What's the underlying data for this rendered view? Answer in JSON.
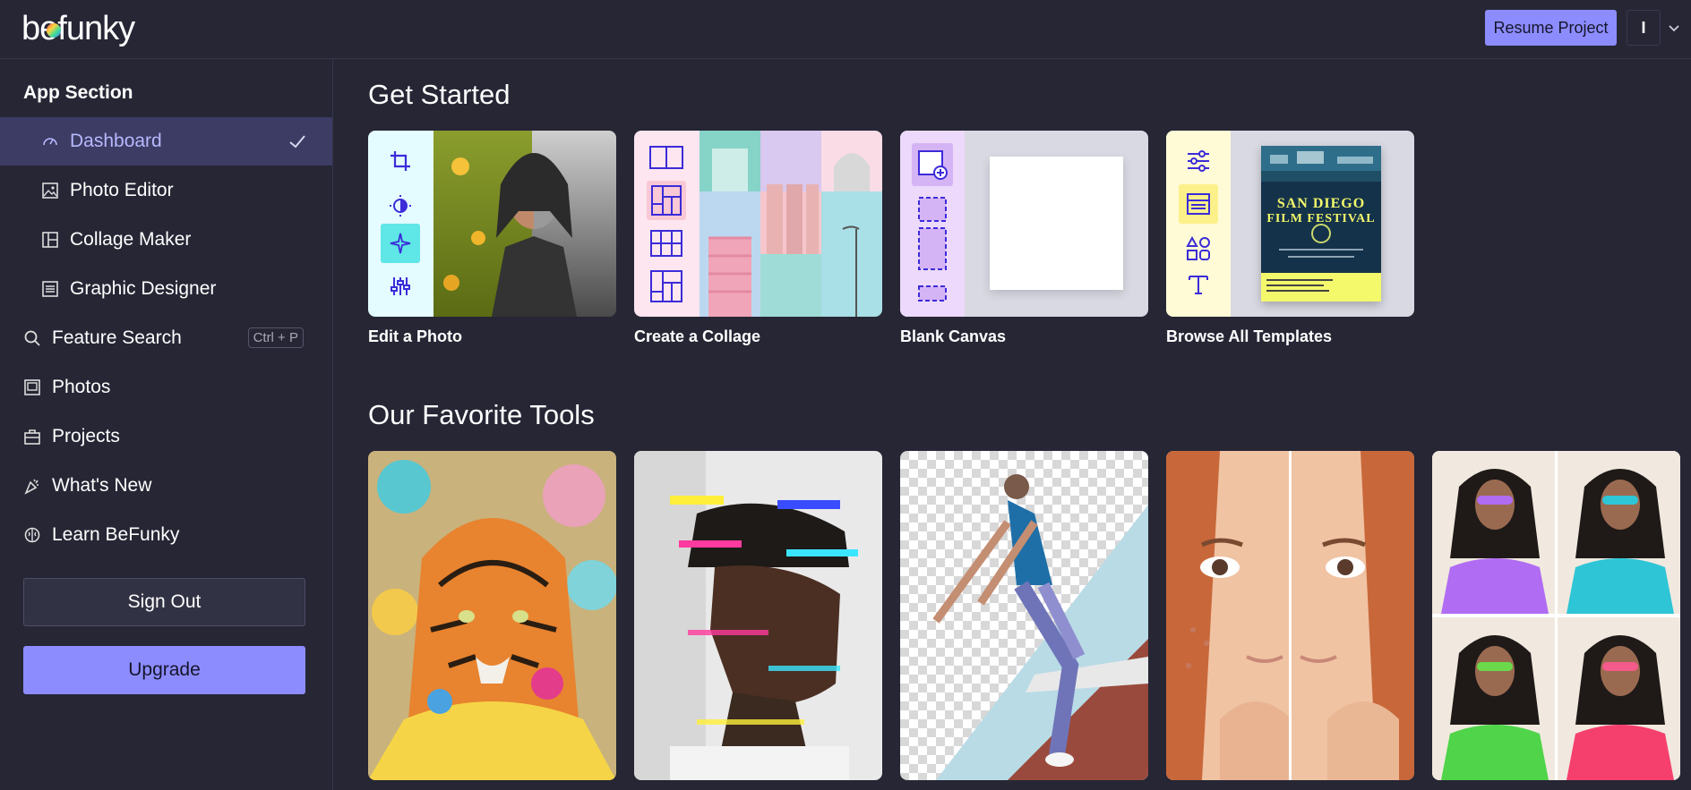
{
  "app": {
    "logo_text": "befunky"
  },
  "topbar": {
    "resume_label": "Resume Project",
    "user_initial": "I"
  },
  "sidebar": {
    "section_title": "App Section",
    "items": [
      {
        "label": "Dashboard",
        "icon": "gauge-icon",
        "active": true
      },
      {
        "label": "Photo Editor",
        "icon": "image-icon"
      },
      {
        "label": "Collage Maker",
        "icon": "collage-icon"
      },
      {
        "label": "Graphic Designer",
        "icon": "layout-icon"
      },
      {
        "label": "Feature Search",
        "icon": "search-icon",
        "shortcut": "Ctrl + P"
      },
      {
        "label": "Photos",
        "icon": "photos-icon"
      },
      {
        "label": "Projects",
        "icon": "briefcase-icon"
      },
      {
        "label": "What's New",
        "icon": "party-icon"
      },
      {
        "label": "Learn BeFunky",
        "icon": "brain-icon"
      }
    ],
    "sign_out_label": "Sign Out",
    "upgrade_label": "Upgrade"
  },
  "main": {
    "get_started_heading": "Get Started",
    "get_started_cards": [
      {
        "label": "Edit a Photo"
      },
      {
        "label": "Create a Collage"
      },
      {
        "label": "Blank Canvas"
      },
      {
        "label": "Browse All Templates"
      }
    ],
    "template_preview": {
      "line1": "SAN DIEGO",
      "line2": "FILM FESTIVAL"
    },
    "favorite_tools_heading": "Our Favorite Tools"
  },
  "colors": {
    "background": "#262635",
    "accent": "#8c8cff",
    "active_item_bg": "#3c3c64",
    "active_item_text": "#b8b8ff"
  }
}
